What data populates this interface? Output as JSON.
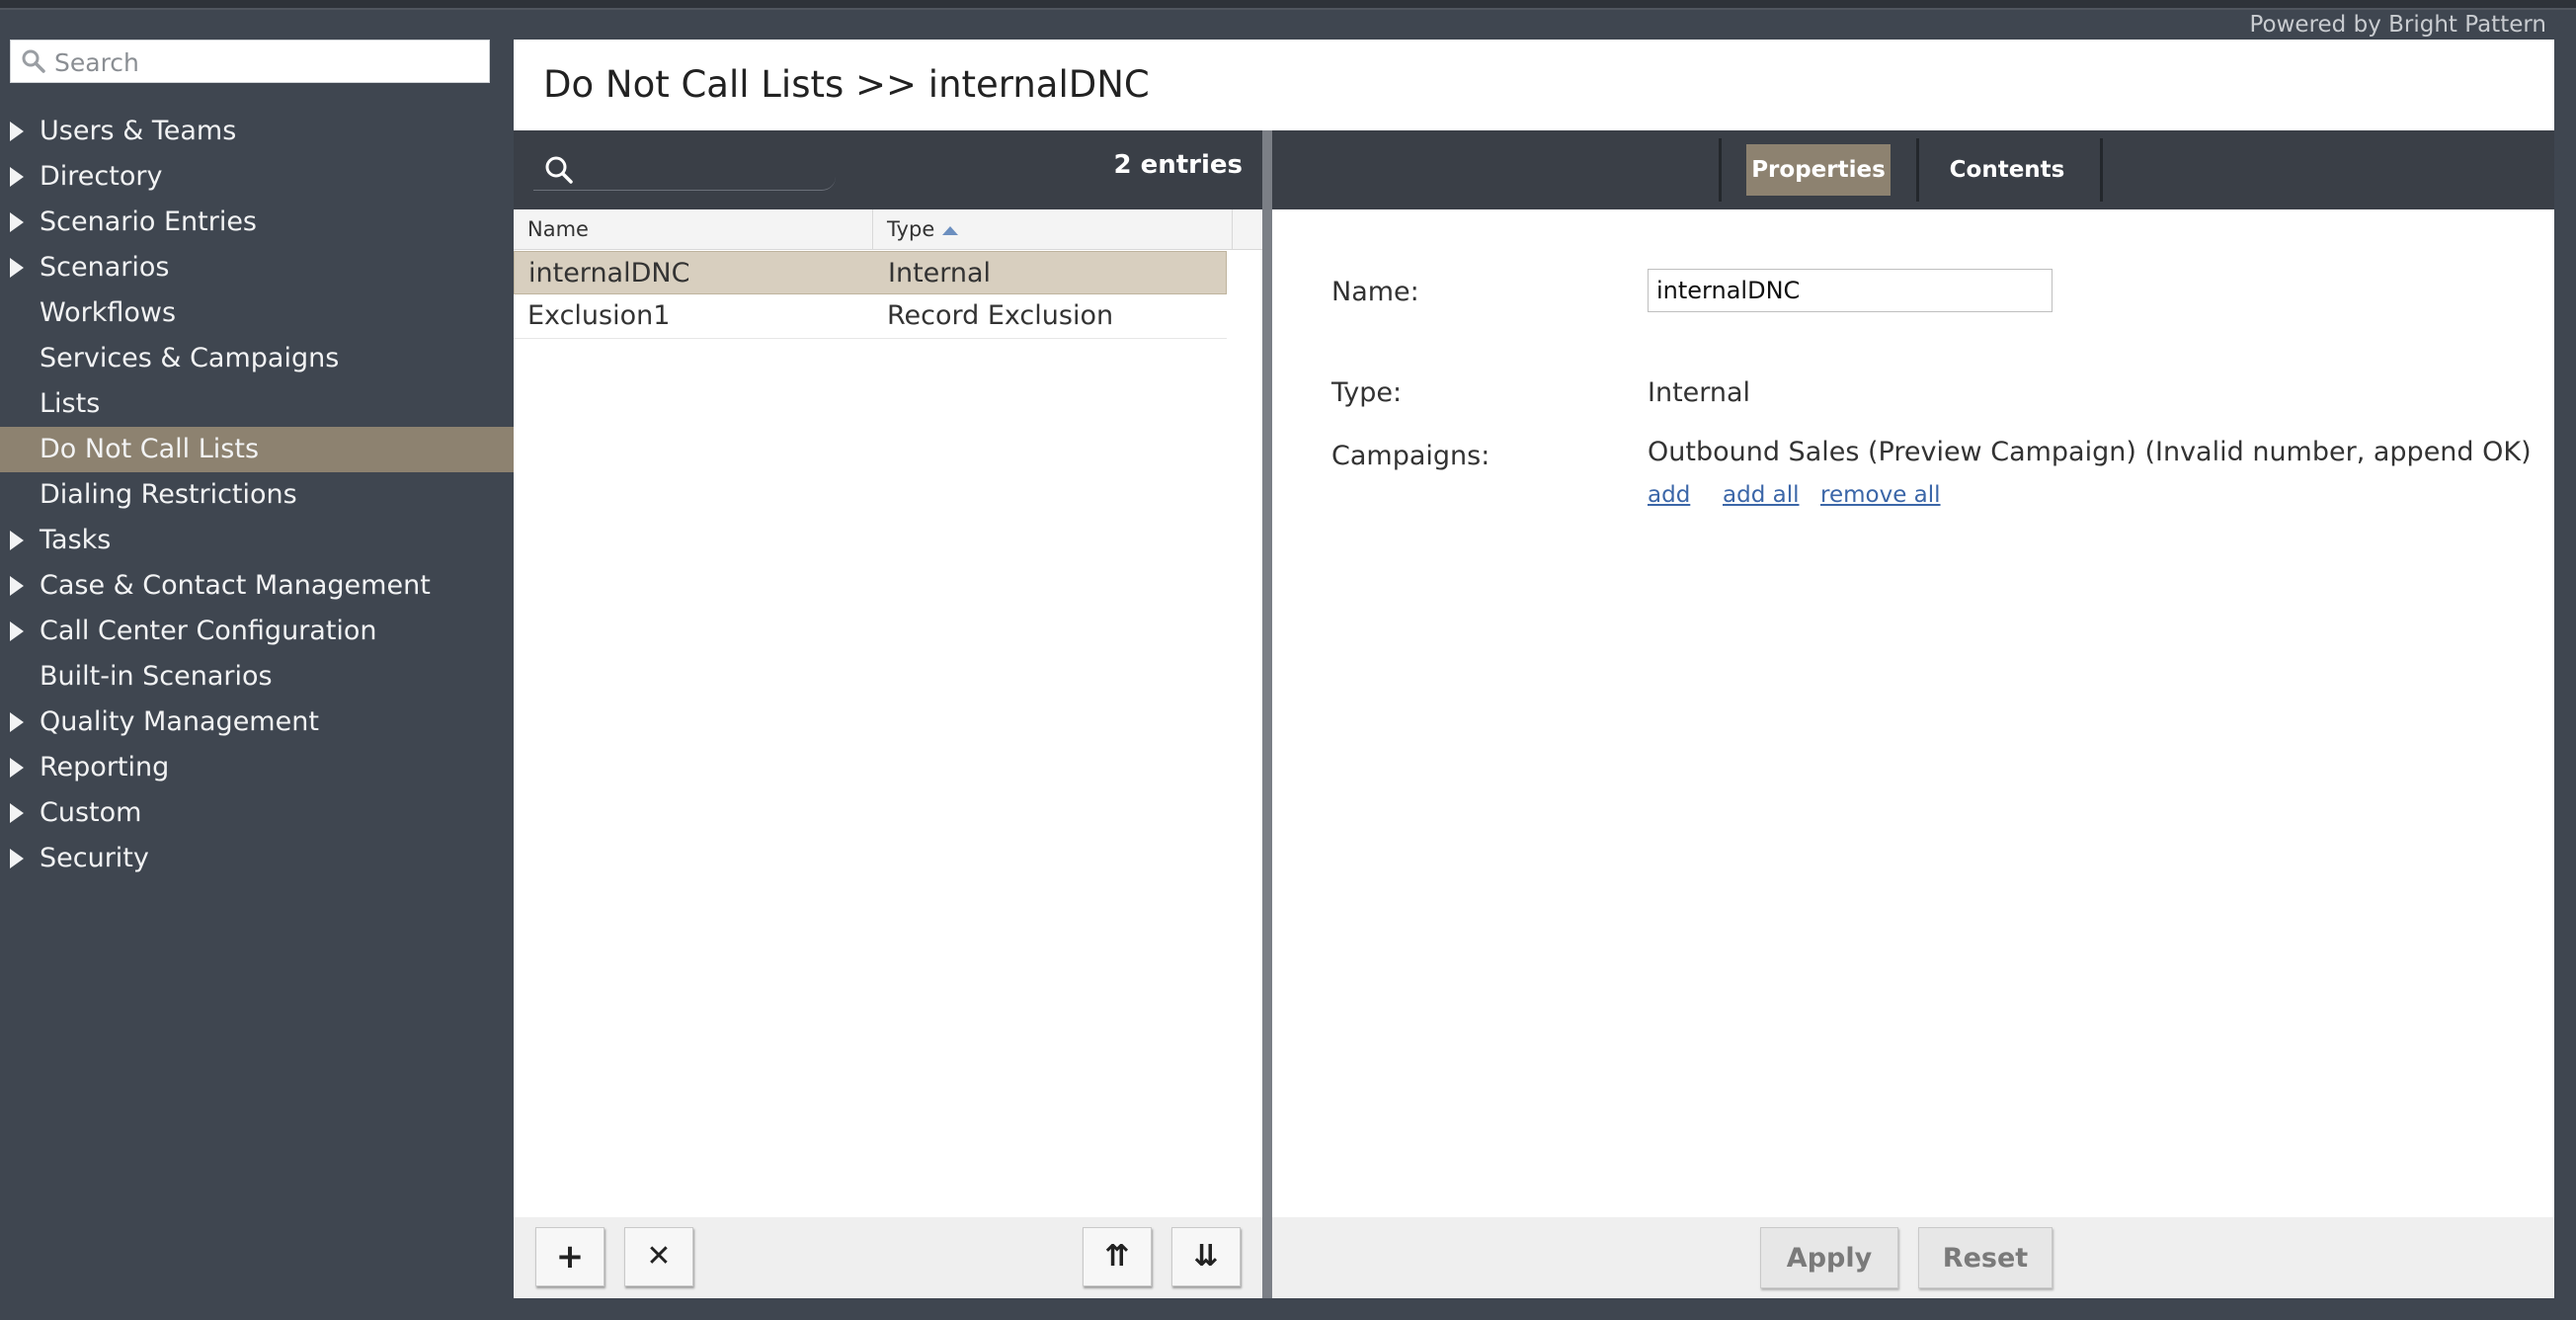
{
  "header": {
    "powered_by": "Powered by Bright Pattern"
  },
  "sidebar": {
    "search_placeholder": "Search",
    "items": [
      {
        "label": "Users & Teams",
        "expandable": true
      },
      {
        "label": "Directory",
        "expandable": true
      },
      {
        "label": "Scenario Entries",
        "expandable": true
      },
      {
        "label": "Scenarios",
        "expandable": true
      },
      {
        "label": "Workflows",
        "expandable": false
      },
      {
        "label": "Services & Campaigns",
        "expandable": false
      },
      {
        "label": "Lists",
        "expandable": false
      },
      {
        "label": "Do Not Call Lists",
        "expandable": false,
        "selected": true
      },
      {
        "label": "Dialing Restrictions",
        "expandable": false
      },
      {
        "label": "Tasks",
        "expandable": true
      },
      {
        "label": "Case & Contact Management",
        "expandable": true
      },
      {
        "label": "Call Center Configuration",
        "expandable": true
      },
      {
        "label": "Built-in Scenarios",
        "expandable": false
      },
      {
        "label": "Quality Management",
        "expandable": true
      },
      {
        "label": "Reporting",
        "expandable": true
      },
      {
        "label": "Custom",
        "expandable": true
      },
      {
        "label": "Security",
        "expandable": true
      }
    ]
  },
  "main": {
    "title": "Do Not Call Lists >> internalDNC",
    "list": {
      "entries_count": "2 entries",
      "columns": [
        "Name",
        "Type"
      ],
      "rows": [
        {
          "name": "internalDNC",
          "type": "Internal",
          "selected": true
        },
        {
          "name": "Exclusion1",
          "type": "Record Exclusion",
          "selected": false
        }
      ],
      "buttons": {
        "add": "+",
        "delete": "✕",
        "move_top": "⇈",
        "move_bottom": "⇊"
      }
    },
    "tabs": [
      {
        "label": "Properties",
        "active": true
      },
      {
        "label": "Contents",
        "active": false
      }
    ],
    "properties": {
      "name_label": "Name:",
      "name_value": "internalDNC",
      "type_label": "Type:",
      "type_value": "Internal",
      "campaigns_label": "Campaigns:",
      "campaigns_value": "Outbound Sales (Preview Campaign) (Invalid number, append OK)",
      "links": {
        "add": "add",
        "add_all": "add all",
        "remove_all": "remove all"
      }
    },
    "actions": {
      "apply": "Apply",
      "reset": "Reset"
    }
  },
  "colors": {
    "selected_bg": "#8d8270",
    "sidebar_bg": "#3f4650",
    "toolbar_bg": "#3a3f47",
    "link": "#3b66a8"
  }
}
